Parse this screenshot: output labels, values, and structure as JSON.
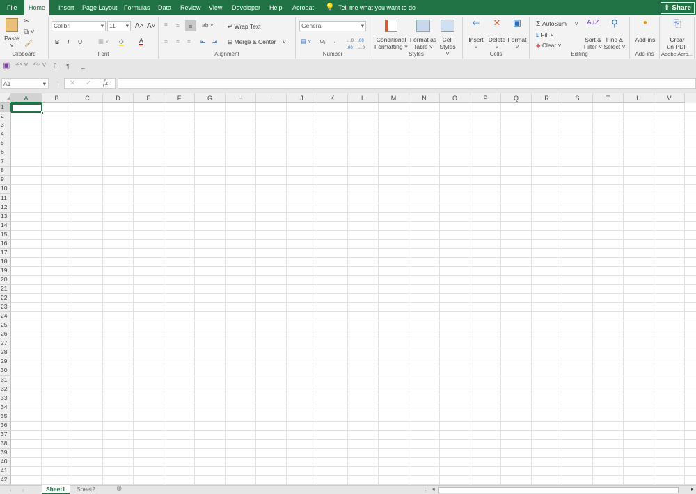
{
  "tabs": [
    "File",
    "Home",
    "Insert",
    "Page Layout",
    "Formulas",
    "Data",
    "Review",
    "View",
    "Developer",
    "Help",
    "Acrobat"
  ],
  "active_tab": "Home",
  "tell_me": "Tell me what you want to do",
  "share": "Share",
  "clipboard": {
    "paste": "Paste",
    "label": "Clipboard"
  },
  "font": {
    "name": "Calibri",
    "size": "11",
    "label": "Font",
    "bold": "B",
    "italic": "I",
    "underline": "U"
  },
  "alignment": {
    "wrap": "Wrap Text",
    "merge": "Merge & Center",
    "label": "Alignment"
  },
  "number": {
    "format": "General",
    "label": "Number",
    "percent": "%",
    "comma": ","
  },
  "styles": {
    "conditional": [
      "Conditional",
      "Formatting ˅"
    ],
    "format_table": [
      "Format as",
      "Table ˅"
    ],
    "cell_styles": [
      "Cell",
      "Styles ˅"
    ],
    "label": "Styles"
  },
  "cells": {
    "insert": "Insert",
    "delete": "Delete",
    "format": "Format",
    "label": "Cells"
  },
  "editing": {
    "autosum": "AutoSum",
    "fill": "Fill ˅",
    "clear": "Clear ˅",
    "sort": [
      "Sort &",
      "Filter ˅"
    ],
    "find": [
      "Find &",
      "Select ˅"
    ],
    "label": "Editing"
  },
  "addins": {
    "button": "Add-ins",
    "label": "Add-ins"
  },
  "adobe": {
    "button": [
      "Crear",
      "un PDF"
    ],
    "label": "Adobe Acro..."
  },
  "name_box": "A1",
  "formula": "",
  "fx": "fx",
  "columns": [
    "A",
    "B",
    "C",
    "D",
    "E",
    "F",
    "G",
    "H",
    "I",
    "J",
    "K",
    "L",
    "M",
    "N",
    "O",
    "P",
    "Q",
    "R",
    "S",
    "T",
    "U",
    "V"
  ],
  "row_count": 42,
  "selected_cell": "A1",
  "sheets": [
    "Sheet1",
    "Sheet2"
  ],
  "active_sheet": "Sheet1",
  "colors": {
    "accent": "#217346"
  }
}
